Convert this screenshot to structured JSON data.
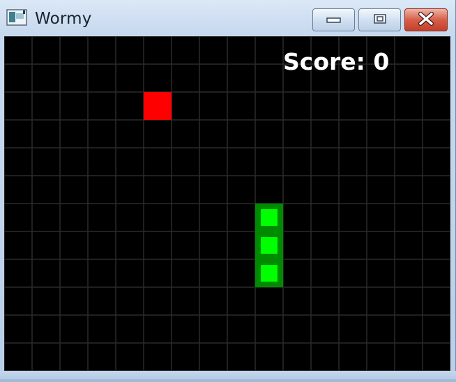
{
  "window": {
    "title": "Wormy",
    "controls": {
      "minimize_icon": "minimize-icon",
      "maximize_icon": "maximize-icon",
      "close_icon": "close-icon"
    }
  },
  "game": {
    "score_text": "Score: 0",
    "grid": {
      "columns": 16,
      "rows": 12,
      "cell_size_label": "cell"
    },
    "apple": {
      "col": 5,
      "row": 2,
      "color": "#ff0000"
    },
    "worm": {
      "segments": [
        {
          "col": 9,
          "row": 6
        },
        {
          "col": 9,
          "row": 7
        },
        {
          "col": 9,
          "row": 8
        }
      ],
      "outer_color": "#008a00",
      "inner_color": "#00ff00"
    },
    "colors": {
      "background": "#000000",
      "grid_line": "#2a2a2a"
    }
  }
}
